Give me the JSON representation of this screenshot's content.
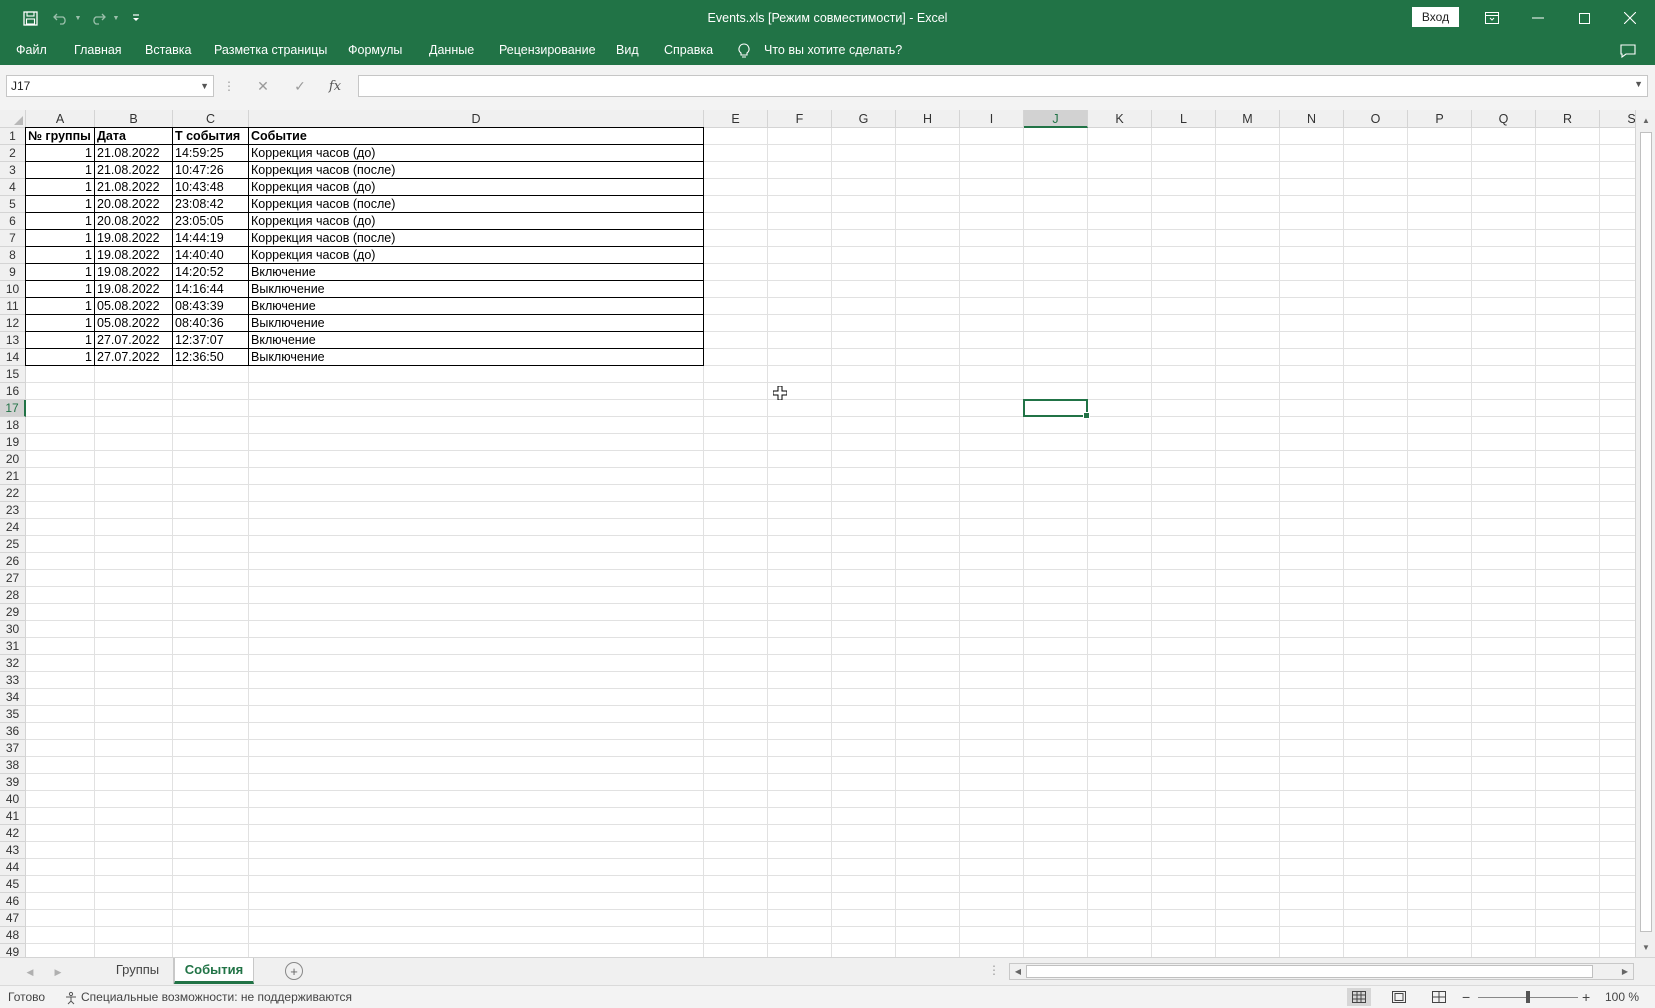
{
  "window": {
    "title": "Events.xls  [Режим совместимости]  -  Excel",
    "sign_in": "Вход"
  },
  "ribbon": {
    "tabs": [
      "Файл",
      "Главная",
      "Вставка",
      "Разметка страницы",
      "Формулы",
      "Данные",
      "Рецензирование",
      "Вид",
      "Справка"
    ],
    "search": "Что вы хотите сделать?"
  },
  "formula_bar": {
    "name_box": "J17",
    "formula": "",
    "fx": "fx"
  },
  "sheet": {
    "columns": [
      "A",
      "B",
      "C",
      "D",
      "E",
      "F",
      "G",
      "H",
      "I",
      "J",
      "K",
      "L",
      "M",
      "N",
      "O",
      "P",
      "Q",
      "R",
      "S"
    ],
    "row_count": 49,
    "selected_column": "J",
    "selected_row": 17,
    "header": [
      "№ группы",
      "Дата",
      "Т события",
      "Событие"
    ],
    "rows": [
      [
        "1",
        "21.08.2022",
        "14:59:25",
        "Коррекция часов (до)"
      ],
      [
        "1",
        "21.08.2022",
        "10:47:26",
        "Коррекция часов (после)"
      ],
      [
        "1",
        "21.08.2022",
        "10:43:48",
        "Коррекция часов (до)"
      ],
      [
        "1",
        "20.08.2022",
        "23:08:42",
        "Коррекция часов (после)"
      ],
      [
        "1",
        "20.08.2022",
        "23:05:05",
        "Коррекция часов (до)"
      ],
      [
        "1",
        "19.08.2022",
        "14:44:19",
        "Коррекция часов (после)"
      ],
      [
        "1",
        "19.08.2022",
        "14:40:40",
        "Коррекция часов (до)"
      ],
      [
        "1",
        "19.08.2022",
        "14:20:52",
        "Включение"
      ],
      [
        "1",
        "19.08.2022",
        "14:16:44",
        "Выключение"
      ],
      [
        "1",
        "05.08.2022",
        "08:43:39",
        "Включение"
      ],
      [
        "1",
        "05.08.2022",
        "08:40:36",
        "Выключение"
      ],
      [
        "1",
        "27.07.2022",
        "12:37:07",
        "Включение"
      ],
      [
        "1",
        "27.07.2022",
        "12:36:50",
        "Выключение"
      ]
    ]
  },
  "sheet_tabs": {
    "tabs": [
      "Группы",
      "События"
    ],
    "active": "События"
  },
  "status": {
    "ready": "Готово",
    "accessibility": "Специальные возможности: не поддерживаются",
    "zoom": "100 %"
  },
  "colors": {
    "accent": "#217346",
    "grid": "#e1e1e1",
    "header_bg": "#f0f0f0"
  }
}
